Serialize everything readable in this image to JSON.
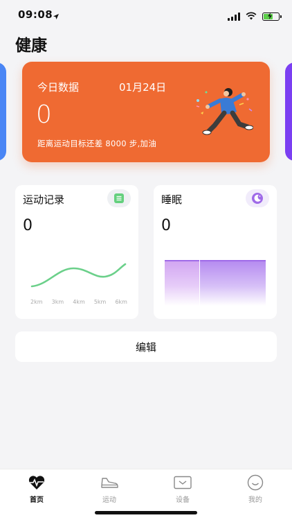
{
  "status_bar": {
    "time": "09:08"
  },
  "page": {
    "title": "健康"
  },
  "today_card": {
    "label": "今日数据",
    "date": "01月24日",
    "steps": "0",
    "goal_text": "距离运动目标还差 8000 步,加油"
  },
  "exercise_card": {
    "title": "运动记录",
    "value": "0",
    "km_labels": [
      "2km",
      "3km",
      "4km",
      "5km",
      "6km"
    ],
    "icon": "list-icon",
    "accent": "#64d07e"
  },
  "sleep_card": {
    "title": "睡眠",
    "value": "0",
    "icon": "moon-icon",
    "accent": "#9f6ae8"
  },
  "edit_button": {
    "label": "编辑"
  },
  "tabs": [
    {
      "label": "首页",
      "icon": "heartbeat-icon",
      "active": true
    },
    {
      "label": "运动",
      "icon": "shoe-icon",
      "active": false
    },
    {
      "label": "设备",
      "icon": "device-icon",
      "active": false
    },
    {
      "label": "我的",
      "icon": "smile-icon",
      "active": false
    }
  ],
  "colors": {
    "today_card_bg": "#ef6a32",
    "left_card_bg": "#4a86f5",
    "right_card_bg": "#7b3ff2"
  }
}
